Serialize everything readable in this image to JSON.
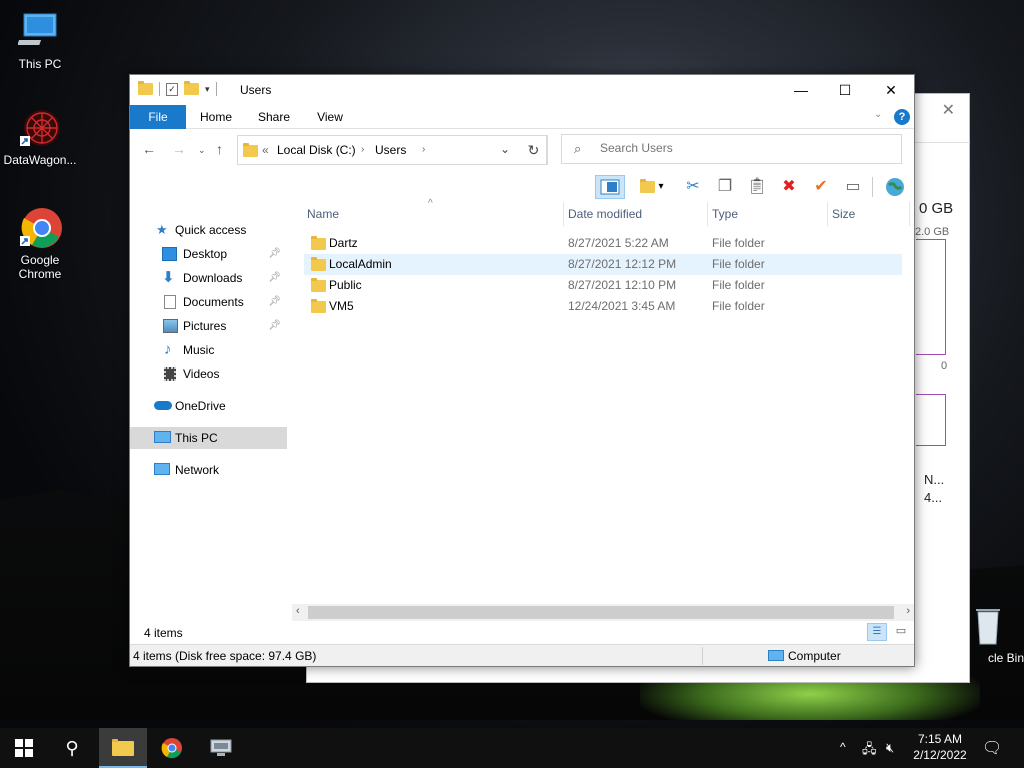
{
  "desktop": {
    "icons": [
      {
        "label": "This PC"
      },
      {
        "label": "DataWagon..."
      },
      {
        "label": "Google Chrome"
      },
      {
        "label": "cle Bin"
      }
    ]
  },
  "background_window": {
    "values": [
      "0 GB",
      "2.0 GB",
      "0",
      "N...",
      "4..."
    ]
  },
  "explorer": {
    "title": "Users",
    "window_controls": {
      "minimize": "—",
      "maximize": "☐",
      "close": "✕"
    },
    "ribbon_tabs": [
      "File",
      "Home",
      "Share",
      "View"
    ],
    "address": {
      "overflow": "«",
      "segments": [
        "Local Disk (C:)",
        "Users"
      ]
    },
    "search_placeholder": "Search Users",
    "sidebar": [
      {
        "label": "Quick access",
        "icon": "star-icon"
      },
      {
        "label": "Desktop",
        "icon": "desktop-folder-icon",
        "pinned": true
      },
      {
        "label": "Downloads",
        "icon": "downloads-icon",
        "pinned": true
      },
      {
        "label": "Documents",
        "icon": "documents-icon",
        "pinned": true
      },
      {
        "label": "Pictures",
        "icon": "pictures-icon",
        "pinned": true
      },
      {
        "label": "Music",
        "icon": "music-icon"
      },
      {
        "label": "Videos",
        "icon": "videos-icon"
      },
      {
        "label": "OneDrive",
        "icon": "cloud-icon"
      },
      {
        "label": "This PC",
        "icon": "computer-icon",
        "selected": true
      },
      {
        "label": "Network",
        "icon": "network-icon"
      }
    ],
    "columns": [
      "Name",
      "Date modified",
      "Type",
      "Size"
    ],
    "rows": [
      {
        "name": "Dartz",
        "date": "8/27/2021 5:22 AM",
        "type": "File folder"
      },
      {
        "name": "LocalAdmin",
        "date": "8/27/2021 12:12 PM",
        "type": "File folder"
      },
      {
        "name": "Public",
        "date": "8/27/2021 12:10 PM",
        "type": "File folder"
      },
      {
        "name": "VM5",
        "date": "12/24/2021 3:45 AM",
        "type": "File folder"
      }
    ],
    "item_count": "4 items",
    "status_detail": "4 items (Disk free space: 97.4 GB)",
    "status_location": "Computer"
  },
  "taskbar": {
    "time": "7:15 AM",
    "date": "2/12/2022"
  },
  "colors": {
    "accent": "#1979ca",
    "folder": "#f2c94c",
    "row_highlight": "#e5f3ff",
    "delete_red": "#e02020",
    "check_orange": "#e8731e"
  }
}
